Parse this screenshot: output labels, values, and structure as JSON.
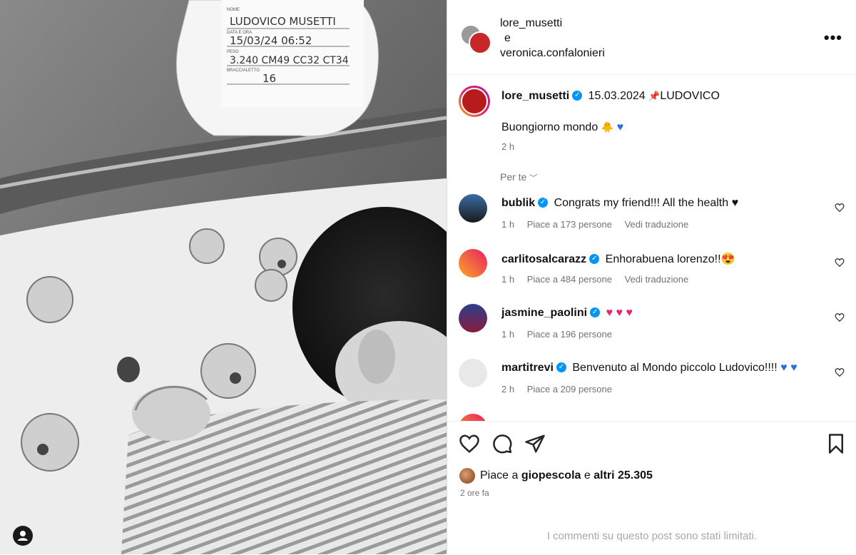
{
  "header": {
    "user1": "lore_musetti",
    "conj": "e",
    "user2": "veronica.confalonieri",
    "more_icon": "more-horizontal-icon"
  },
  "card": {
    "name": "LUDOVICO MUSETTI",
    "date_line": "15/03/24   06:52",
    "stats_line": "3.240  CM49  CC32  CT34",
    "bracelet": "16",
    "lbl_nome": "NOME",
    "lbl_data": "DATA E ORA",
    "lbl_peso": "PESO",
    "lbl_brac": "BRACCIALETTO"
  },
  "caption": {
    "user": "lore_musetti",
    "text_head": "15.03.2024",
    "text_tail": "LUDOVICO",
    "body": "Buongiorno mondo",
    "time": "2 h"
  },
  "per_te": "Per te",
  "comments": [
    {
      "user": "bublik",
      "text": "Congrats my friend!!! All the health",
      "emoji": "♥",
      "time": "1 h",
      "likes": "Piace a 173 persone",
      "translate": "Vedi traduzione"
    },
    {
      "user": "carlitosalcarazz",
      "text": "Enhorabuena lorenzo!!",
      "emoji": "😍",
      "time": "1 h",
      "likes": "Piace a 484 persone",
      "translate": "Vedi traduzione"
    },
    {
      "user": "jasmine_paolini",
      "text": "",
      "emoji": "♥ ♥ ♥",
      "time": "1 h",
      "likes": "Piace a 196 persone",
      "translate": ""
    },
    {
      "user": "martitrevi",
      "text": "Benvenuto al Mondo piccolo Ludovico!!!!",
      "emoji": "♥ ♥",
      "time": "2 h",
      "likes": "Piace a 209 persone",
      "translate": ""
    }
  ],
  "likes": {
    "prefix": "Piace a",
    "user": "giopescola",
    "mid": "e",
    "others": "altri 25.305"
  },
  "ago": "2 ore fa",
  "limited": "I commenti su questo post sono stati limitati.",
  "colors": {
    "verified": "#0095f6",
    "heart": "#e8246c",
    "blue_heart": "#2a6ee0"
  }
}
